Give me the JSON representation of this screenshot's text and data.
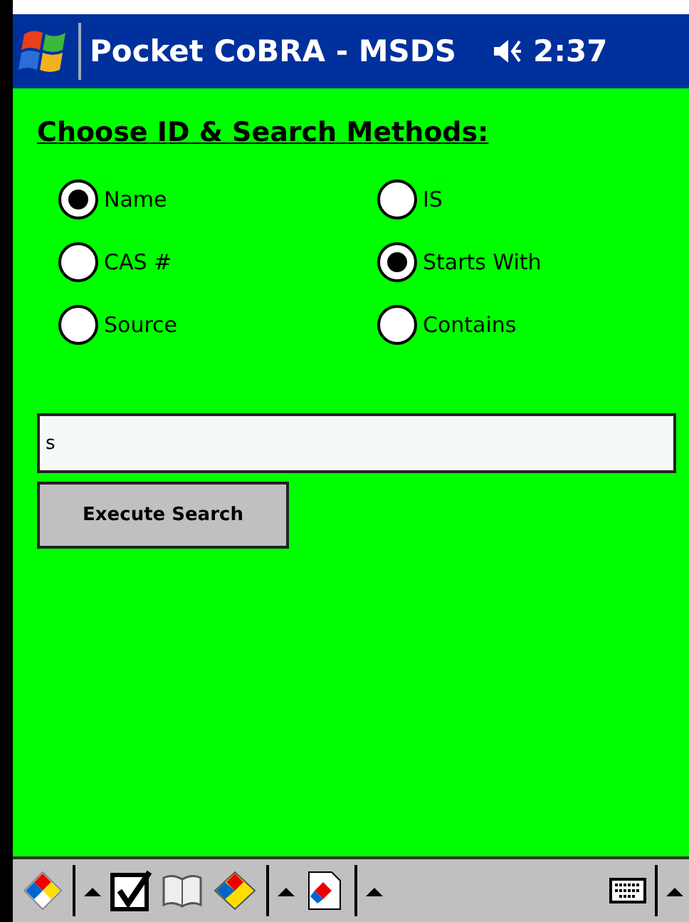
{
  "title_bar": {
    "title": "Pocket CoBRA - MSDS",
    "time": "2:37"
  },
  "heading": "Choose ID & Search Methods:",
  "id_options": [
    {
      "label": "Name",
      "selected": true
    },
    {
      "label": "CAS #",
      "selected": false
    },
    {
      "label": "Source",
      "selected": false
    }
  ],
  "search_options": [
    {
      "label": "IS",
      "selected": false
    },
    {
      "label": "Starts With",
      "selected": true
    },
    {
      "label": "Contains",
      "selected": false
    }
  ],
  "search_field": {
    "value": "s"
  },
  "buttons": [
    "Execute Search"
  ]
}
